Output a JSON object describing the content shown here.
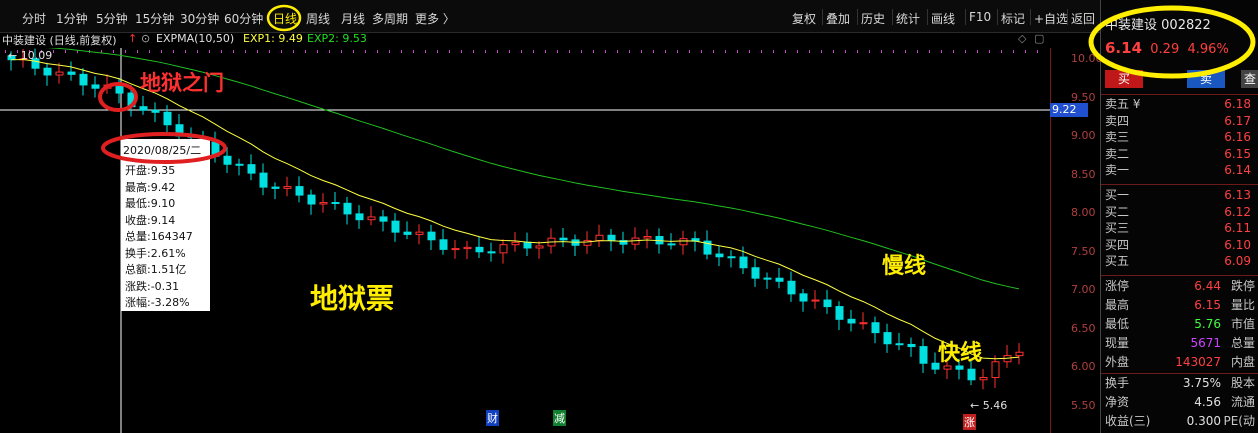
{
  "toolbar": {
    "left_items": [
      "分时",
      "1分钟",
      "5分钟",
      "15分钟",
      "30分钟",
      "60分钟",
      "日线",
      "周线",
      "月线",
      "多周期",
      "更多 〉"
    ],
    "right_items": [
      "复权",
      "叠加",
      "历史",
      "统计",
      "画线",
      "F10",
      "标记",
      "+自选",
      "返回"
    ]
  },
  "indicator": {
    "title": "中装建设 (日线,前复权)",
    "name": "EXPMA(10,50)",
    "exp1": "EXP1: 9.49",
    "exp2": "EXP2: 9.53"
  },
  "chart": {
    "high_label": "10.09",
    "low_label": "5.46",
    "crosshair_price": "9.22",
    "yticks": [
      "10.00",
      "9.50",
      "9.00",
      "8.50",
      "8.00",
      "7.50",
      "7.00",
      "6.50",
      "6.00",
      "5.50"
    ],
    "marker_cai": "财",
    "marker_jian": "减",
    "marker_zhang": "涨"
  },
  "tooltip": {
    "date": "2020/08/25/二",
    "lines": [
      "开盘:9.35",
      "最高:9.42",
      "最低:9.10",
      "收盘:9.14",
      "总量:164347",
      "换手:2.61%",
      "总额:1.51亿",
      "涨跌:-0.31",
      "涨幅:-3.28%"
    ]
  },
  "annotations": {
    "hell_gate": "地狱之门",
    "hell_stock": "地狱票",
    "slow_line": "慢线",
    "fast_line": "快线"
  },
  "stock": {
    "name": "中装建设",
    "code": "002822",
    "price": "6.14",
    "change": "0.29",
    "pct": "4.96%",
    "buy_btn": "买",
    "sell_btn": "卖",
    "third_btn": "查"
  },
  "orderbook": {
    "asks": [
      {
        "label": "卖五 ¥",
        "price": "6.18"
      },
      {
        "label": "卖四",
        "price": "6.17"
      },
      {
        "label": "卖三",
        "price": "6.16"
      },
      {
        "label": "卖二",
        "price": "6.15"
      },
      {
        "label": "卖一",
        "price": "6.14"
      }
    ],
    "bids": [
      {
        "label": "买一",
        "price": "6.13"
      },
      {
        "label": "买二",
        "price": "6.12"
      },
      {
        "label": "买三",
        "price": "6.11"
      },
      {
        "label": "买四",
        "price": "6.10"
      },
      {
        "label": "买五",
        "price": "6.09"
      }
    ]
  },
  "stats": [
    {
      "label": "涨停",
      "value": "6.44",
      "label2": "跌停",
      "color": "#ff4040"
    },
    {
      "label": "最高",
      "value": "6.15",
      "label2": "量比",
      "color": "#ff4040"
    },
    {
      "label": "最低",
      "value": "5.76",
      "label2": "市值",
      "color": "#40ff40"
    },
    {
      "label": "现量",
      "value": "5671",
      "label2": "总量",
      "color": "#cc44ff"
    },
    {
      "label": "外盘",
      "value": "143027",
      "label2": "内盘",
      "color": "#ff4040"
    }
  ],
  "stats2": [
    {
      "label": "换手",
      "value": "3.75%",
      "label2": "股本"
    },
    {
      "label": "净资",
      "value": "4.56",
      "label2": "流通"
    },
    {
      "label": "收益(三)",
      "value": "0.300",
      "label2": "PE(动"
    }
  ],
  "colors": {
    "up": "#ff3030",
    "down": "#00e0e0",
    "fast": "#ffff40",
    "slow": "#20c020",
    "highlight": "#ffee00",
    "mark": "#e02020"
  }
}
